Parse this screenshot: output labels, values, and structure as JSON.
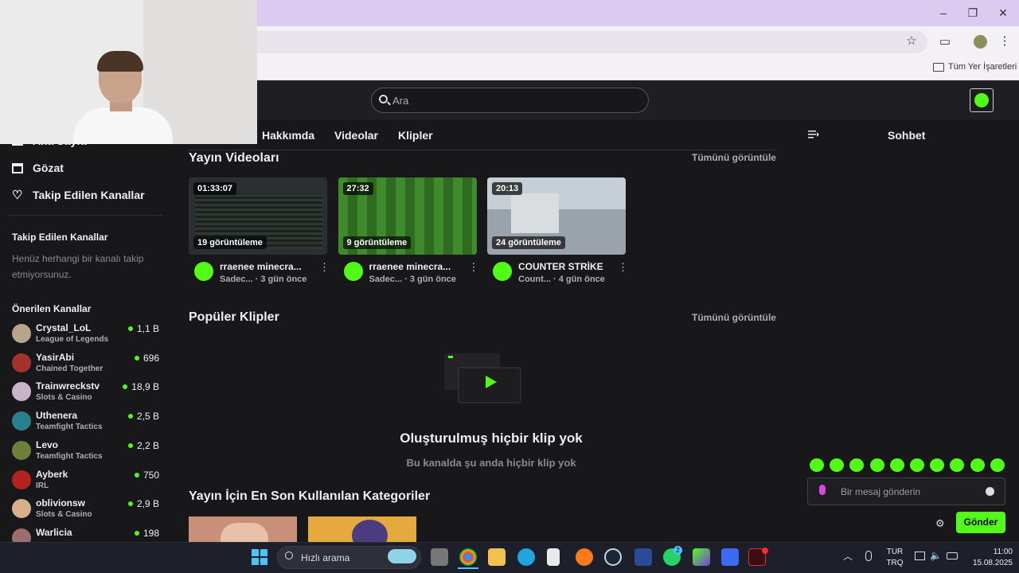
{
  "browser": {
    "bookmarks_label": "Tüm Yer İşaretleri"
  },
  "header": {
    "search_placeholder": "Ara"
  },
  "sidebar": {
    "nav": [
      {
        "label": "Ana Sayfa",
        "icon": "home-icon"
      },
      {
        "label": "Gözat",
        "icon": "browse-icon"
      },
      {
        "label": "Takip Edilen Kanallar",
        "icon": "heart-icon"
      }
    ],
    "followed_title": "Takip Edilen Kanallar",
    "followed_empty": "Henüz herhangi bir kanalı takip etmiyorsunuz.",
    "suggested_title": "Önerilen Kanallar",
    "channels": [
      {
        "name": "Crystal_LoL",
        "category": "League of Legends",
        "viewers": "1,1 B",
        "color": "#b8a38c"
      },
      {
        "name": "YasirAbi",
        "category": "Chained Together",
        "viewers": "696",
        "color": "#a3322b"
      },
      {
        "name": "Trainwreckstv",
        "category": "Slots & Casino",
        "viewers": "18,9 B",
        "color": "#c7b4c9"
      },
      {
        "name": "Uthenera",
        "category": "Teamfight Tactics",
        "viewers": "2,5 B",
        "color": "#2a7f8f"
      },
      {
        "name": "Levo",
        "category": "Teamfight Tactics",
        "viewers": "2,2 B",
        "color": "#6d7f3a"
      },
      {
        "name": "Ayberk",
        "category": "IRL",
        "viewers": "750",
        "color": "#b3241f"
      },
      {
        "name": "oblivionsw",
        "category": "Slots & Casino",
        "viewers": "2,9 B",
        "color": "#d7b08a"
      },
      {
        "name": "Warlicia",
        "category": "",
        "viewers": "198",
        "color": "#9c6d6d"
      }
    ]
  },
  "tabs": [
    "Hakkımda",
    "Videolar",
    "Klipler"
  ],
  "videos_section": {
    "title": "Yayın Videoları",
    "see_all": "Tümünü görüntüle",
    "items": [
      {
        "duration": "01:33:07",
        "views": "19 görüntüleme",
        "title": "rraenee minecra...",
        "channel": "Sadec...",
        "ago": "· 3 gün önce",
        "thumb_color": "#2b2e33"
      },
      {
        "duration": "27:32",
        "views": "9 görüntüleme",
        "title": "rraenee minecra...",
        "channel": "Sadec...",
        "ago": "· 3 gün önce",
        "thumb_color": "#3d7a2a"
      },
      {
        "duration": "20:13",
        "views": "24 görüntüleme",
        "title": "COUNTER STRİKE",
        "channel": "Count...",
        "ago": "· 4 gün önce",
        "thumb_color": "#9aa3ab"
      }
    ]
  },
  "clips_section": {
    "title": "Popüler Klipler",
    "see_all": "Tümünü görüntüle",
    "empty_title": "Oluşturulmuş hiçbir klip yok",
    "empty_sub": "Bu kanalda şu anda hiçbir klip yok"
  },
  "categories_section": {
    "title": "Yayın İçin En Son Kullanılan Kategoriler"
  },
  "chat": {
    "title": "Sohbet",
    "placeholder": "Bir mesaj gönderin",
    "send_label": "Gönder",
    "emote_count": 10
  },
  "taskbar": {
    "search_label": "Hızlı arama",
    "lang_top": "TUR",
    "lang_bottom": "TRQ",
    "time": "11:00",
    "date": "15.08.2025",
    "whatsapp_badge": "2"
  },
  "colors": {
    "brand_green": "#53fc18",
    "background": "#18181a"
  }
}
